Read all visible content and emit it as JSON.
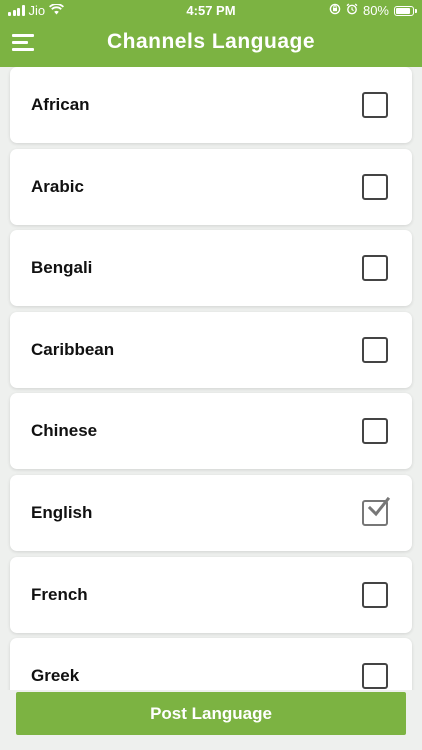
{
  "status_bar": {
    "carrier": "Jio",
    "time": "4:57 PM",
    "battery": "80%"
  },
  "header": {
    "title": "Channels Language"
  },
  "languages": [
    {
      "label": "African",
      "checked": false
    },
    {
      "label": "Arabic",
      "checked": false
    },
    {
      "label": "Bengali",
      "checked": false
    },
    {
      "label": "Caribbean",
      "checked": false
    },
    {
      "label": "Chinese",
      "checked": false
    },
    {
      "label": "English",
      "checked": true
    },
    {
      "label": "French",
      "checked": false
    },
    {
      "label": "Greek",
      "checked": false
    }
  ],
  "footer": {
    "post_label": "Post Language"
  },
  "colors": {
    "accent": "#7cb342"
  }
}
